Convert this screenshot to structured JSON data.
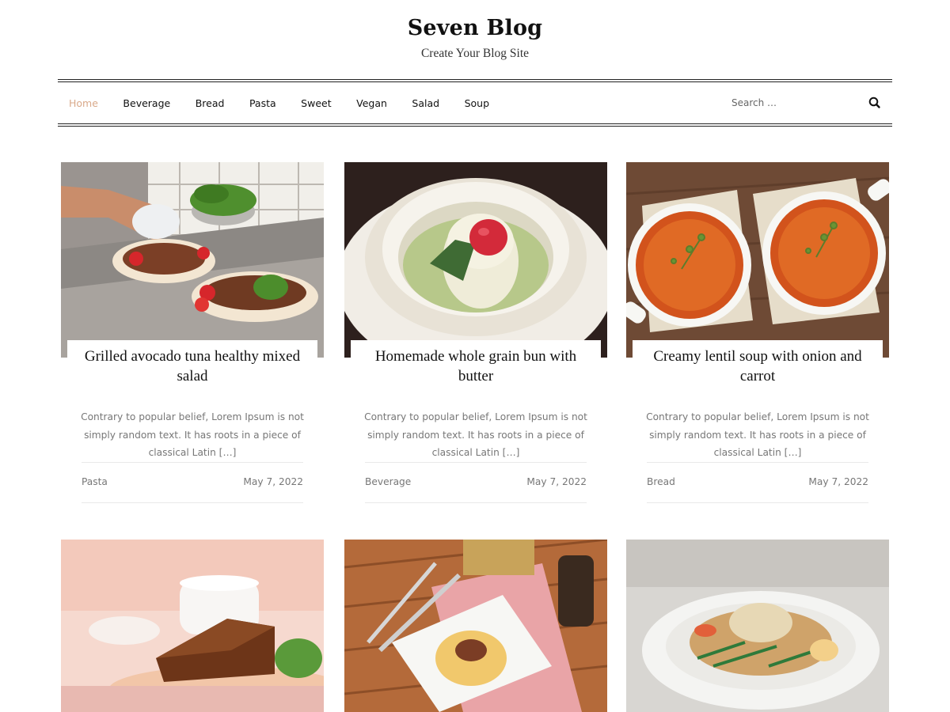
{
  "site": {
    "title": "Seven Blog",
    "tagline": "Create Your Blog Site"
  },
  "nav": {
    "items": [
      {
        "label": "Home",
        "active": true
      },
      {
        "label": "Beverage",
        "active": false
      },
      {
        "label": "Bread",
        "active": false
      },
      {
        "label": "Pasta",
        "active": false
      },
      {
        "label": "Sweet",
        "active": false
      },
      {
        "label": "Vegan",
        "active": false
      },
      {
        "label": "Salad",
        "active": false
      },
      {
        "label": "Soup",
        "active": false
      }
    ],
    "search_placeholder": "Search …",
    "search_icon": "search-icon"
  },
  "posts": [
    {
      "title": "Grilled avocado tuna healthy mixed salad",
      "excerpt": "Contrary to popular belief, Lorem Ipsum is not simply random text. It has roots in a piece of classical Latin […]",
      "category": "Pasta",
      "date": "May 7, 2022"
    },
    {
      "title": "Homemade whole grain bun with butter",
      "excerpt": "Contrary to popular belief, Lorem Ipsum is not simply random text. It has roots in a piece of classical Latin […]",
      "category": "Beverage",
      "date": "May 7, 2022"
    },
    {
      "title": "Creamy lentil soup with onion and carrot",
      "excerpt": "Contrary to popular belief, Lorem Ipsum is not simply random text. It has roots in a piece of classical Latin […]",
      "category": "Bread",
      "date": "May 7, 2022"
    }
  ],
  "colors": {
    "accent": "#d9a98a",
    "text": "#111111",
    "muted": "#777777"
  }
}
